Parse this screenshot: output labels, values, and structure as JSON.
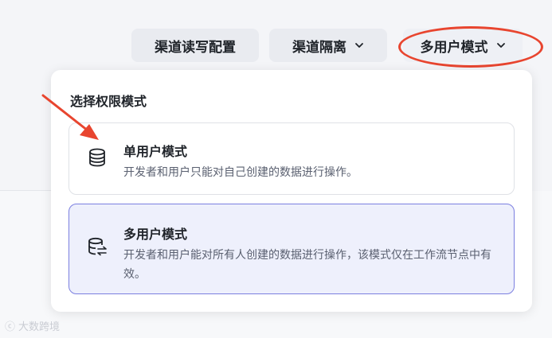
{
  "toolbar": {
    "rw_config_label": "渠道读写配置",
    "isolation_label": "渠道隔离",
    "mode_label": "多用户模式"
  },
  "panel": {
    "title": "选择权限模式",
    "options": [
      {
        "title": "单用户模式",
        "desc": "开发者和用户只能对自己创建的数据进行操作。",
        "icon": "database-icon",
        "selected": false
      },
      {
        "title": "多用户模式",
        "desc": "开发者和用户能对所有人创建的数据进行操作，该模式仅在工作流节点中有效。",
        "icon": "database-swap-icon",
        "selected": true
      }
    ]
  },
  "watermark": {
    "text": "大数跨境"
  },
  "colors": {
    "accent": "#7b7fe0",
    "annotation": "#e8452f",
    "selected_bg": "#eef0fc"
  }
}
